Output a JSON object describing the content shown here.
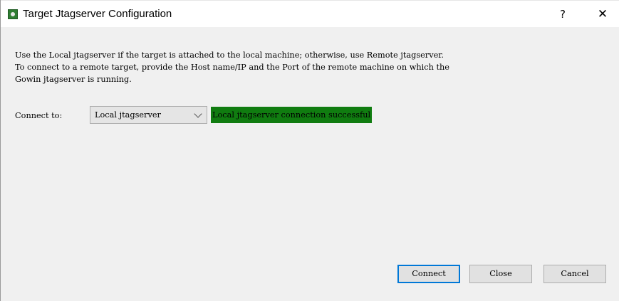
{
  "window": {
    "title": "Target Jtagserver Configuration",
    "help_label": "?",
    "close_label": "✕"
  },
  "description": {
    "line1": "Use the Local jtagserver if the target is attached to the local machine; otherwise, use Remote jtagserver.",
    "line2": "To connect to a remote target, provide the Host name/IP and the Port of the remote machine on which the",
    "line3": "Gowin jtagserver is running."
  },
  "connect": {
    "label": "Connect to:",
    "selected": "Local jtagserver",
    "status": "Local jtagserver connection successful",
    "status_color": "#107c10"
  },
  "buttons": {
    "connect": "Connect",
    "close": "Close",
    "cancel": "Cancel"
  },
  "icons": {
    "app": "app-icon",
    "dropdown": "chevron-down-icon"
  }
}
